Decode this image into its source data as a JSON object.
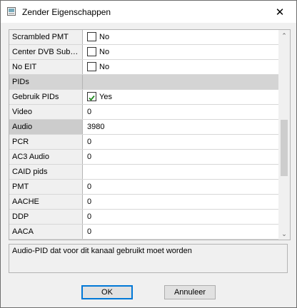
{
  "window": {
    "title": "Zender Eigenschappen"
  },
  "rows": [
    {
      "kind": "check",
      "label": "Scrambled PMT",
      "checked": false,
      "value": "No"
    },
    {
      "kind": "check",
      "label": "Center DVB Sub…",
      "checked": false,
      "value": "No"
    },
    {
      "kind": "check",
      "label": "No EIT",
      "checked": false,
      "value": "No"
    },
    {
      "kind": "section",
      "label": "PIDs",
      "value": ""
    },
    {
      "kind": "check",
      "label": "Gebruik PIDs",
      "checked": true,
      "value": "Yes"
    },
    {
      "kind": "text",
      "label": "Video",
      "value": "0"
    },
    {
      "kind": "text",
      "label": "Audio",
      "value": "3980",
      "selected": true
    },
    {
      "kind": "text",
      "label": "PCR",
      "value": "0"
    },
    {
      "kind": "text",
      "label": "AC3 Audio",
      "value": "0"
    },
    {
      "kind": "text",
      "label": "CAID pids",
      "value": ""
    },
    {
      "kind": "text",
      "label": "PMT",
      "value": "0"
    },
    {
      "kind": "text",
      "label": "AACHE",
      "value": "0"
    },
    {
      "kind": "text",
      "label": "DDP",
      "value": "0"
    },
    {
      "kind": "text",
      "label": "AACA",
      "value": "0"
    }
  ],
  "scrollbar": {
    "position_fraction": 0.6,
    "visible_fraction": 0.3
  },
  "description": "Audio-PID dat voor dit kanaal gebruikt moet worden",
  "buttons": {
    "ok": "OK",
    "cancel": "Annuleer"
  },
  "colors": {
    "accent": "#0078d7",
    "check": "#1f8a1f"
  }
}
